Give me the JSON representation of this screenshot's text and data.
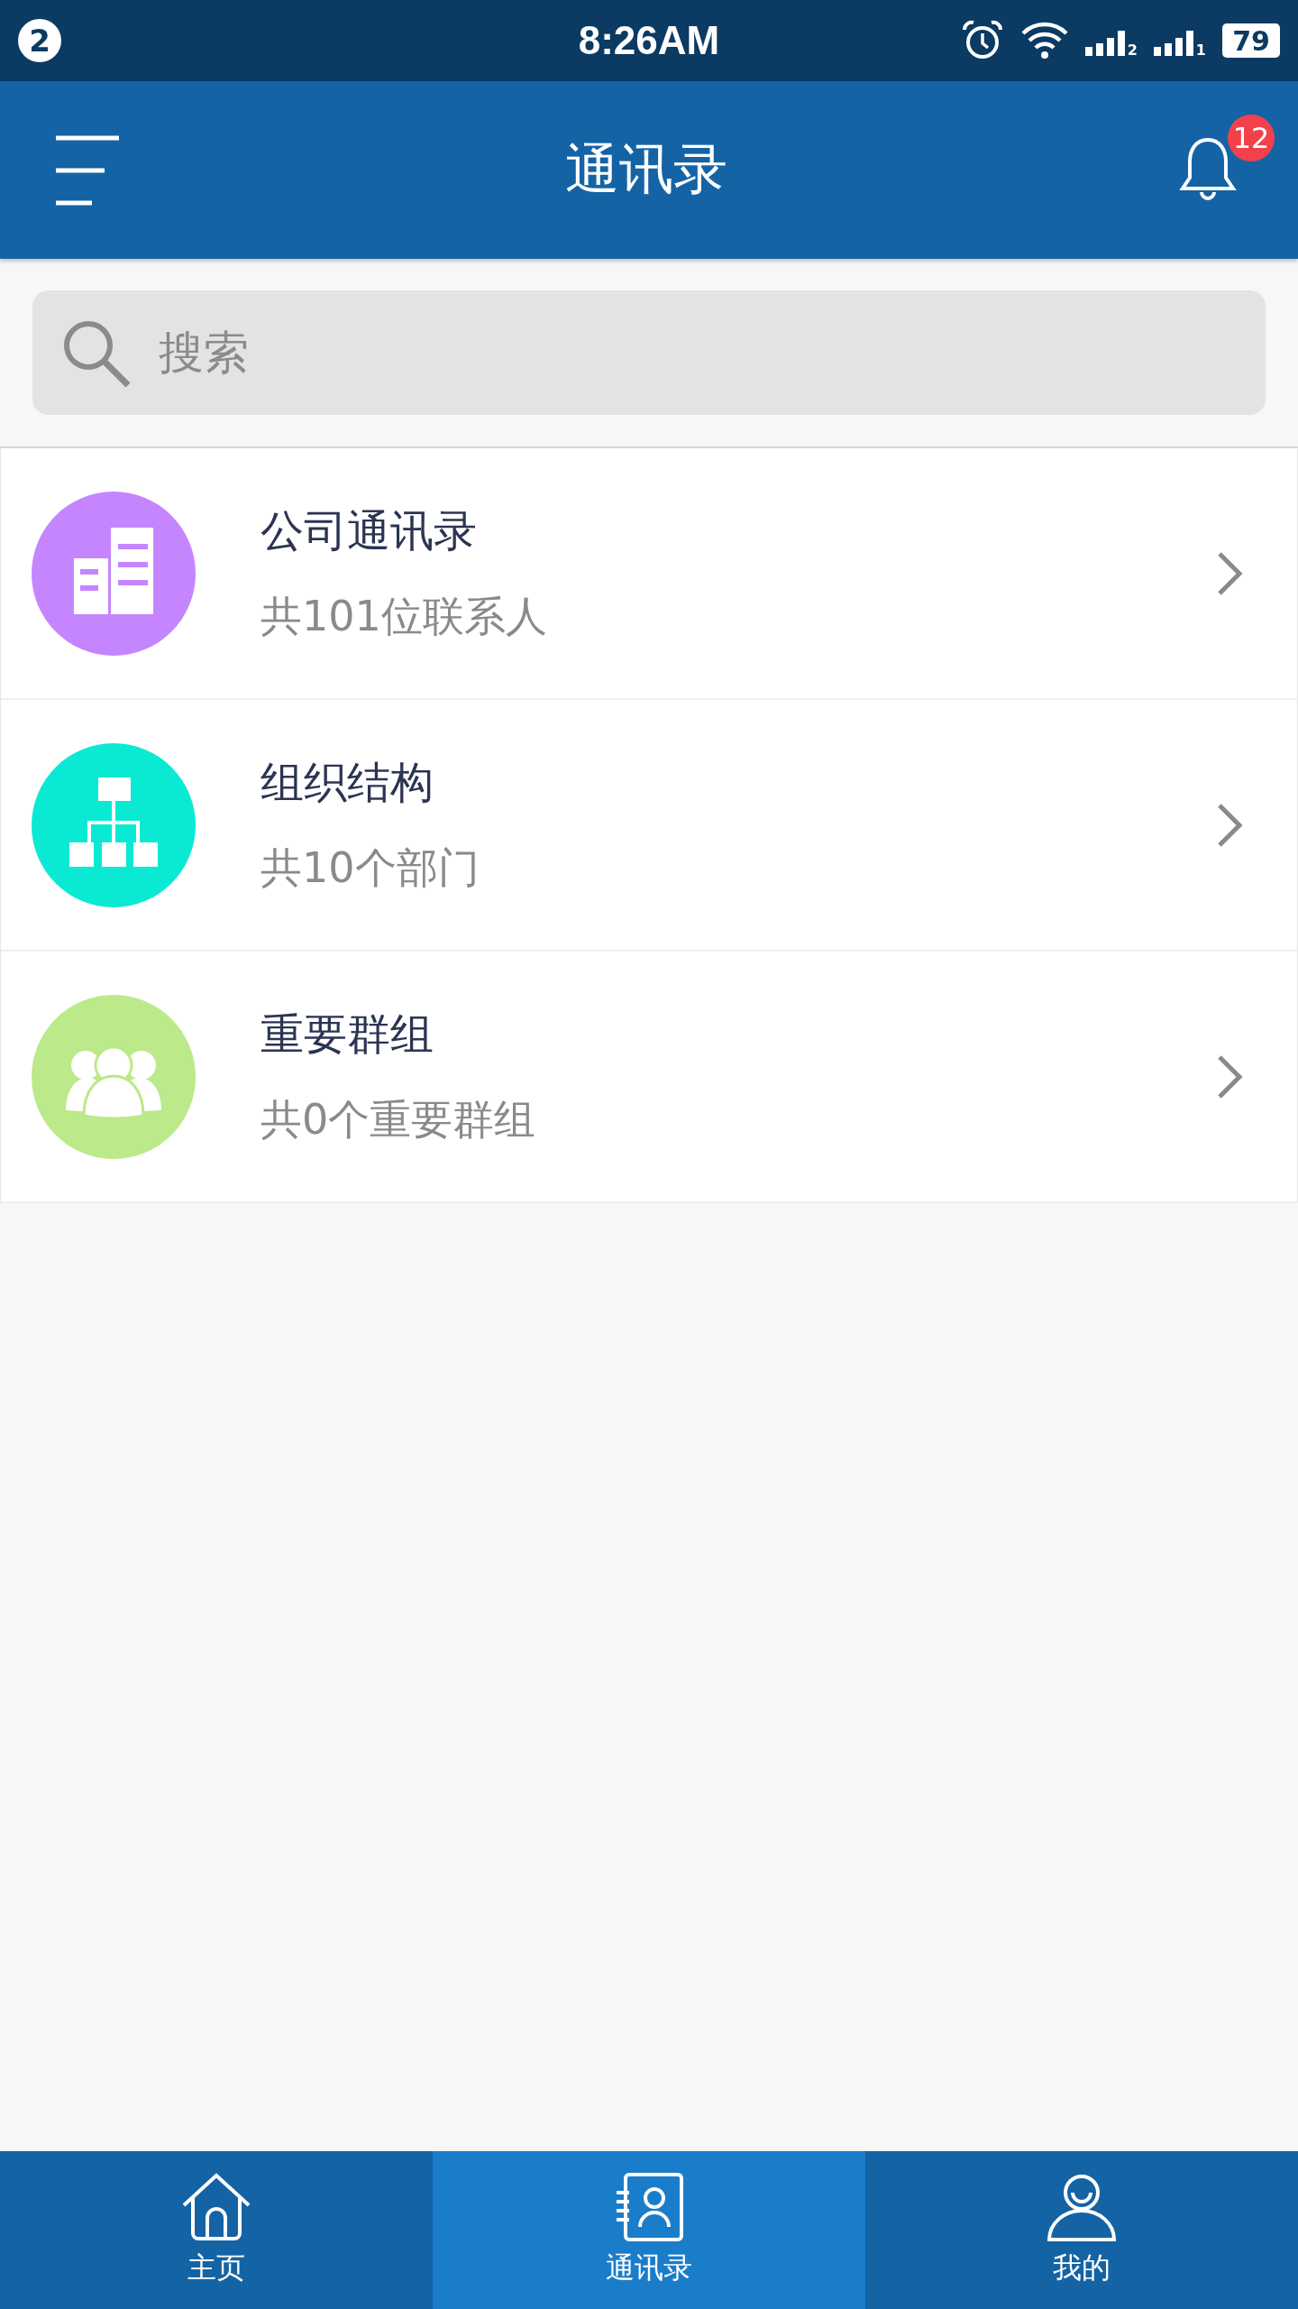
{
  "status_bar": {
    "notification_count": "2",
    "time": "8:26AM",
    "sims": [
      "2",
      "1"
    ],
    "battery": "79"
  },
  "header": {
    "title": "通讯录",
    "badge": "12"
  },
  "search": {
    "placeholder": "搜索"
  },
  "items": [
    {
      "kind": "building",
      "color": "#c585ff",
      "title": "公司通讯录",
      "subtitle": "共101位联系人"
    },
    {
      "kind": "org",
      "color": "#0aead3",
      "title": "组织结构",
      "subtitle": "共10个部门"
    },
    {
      "kind": "group",
      "color": "#bce98a",
      "title": "重要群组",
      "subtitle": "共0个重要群组"
    }
  ],
  "tabs": [
    {
      "kind": "home",
      "label": "主页",
      "selected": false
    },
    {
      "kind": "contacts",
      "label": "通讯录",
      "selected": true
    },
    {
      "kind": "profile",
      "label": "我的",
      "selected": false
    }
  ]
}
